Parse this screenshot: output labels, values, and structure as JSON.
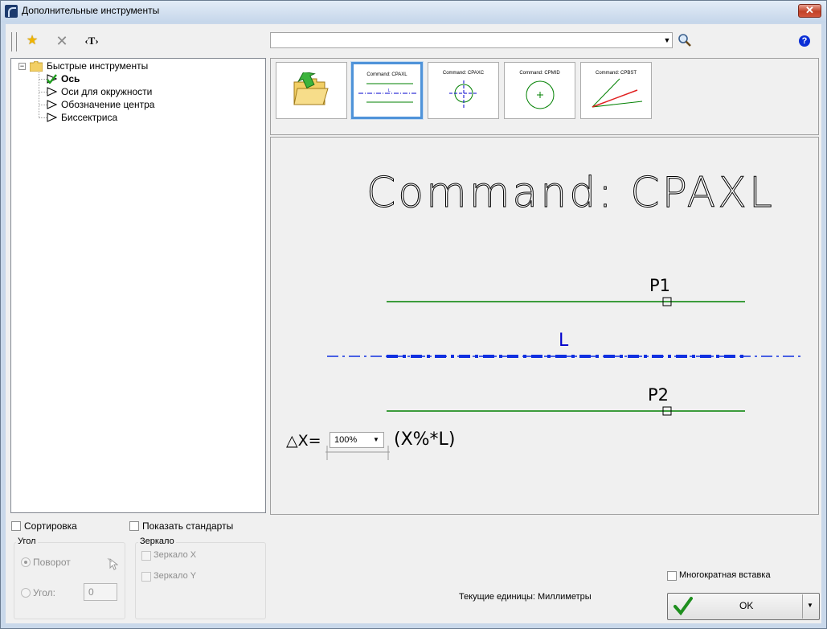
{
  "window": {
    "title": "Дополнительные инструменты",
    "close_glyph": "✕"
  },
  "toolbar": {
    "favorite_icon": "star-icon",
    "delete_icon": "x-icon",
    "text_button": "‹T›",
    "search_value": "",
    "help_glyph": "?"
  },
  "tree": {
    "root_label": "Быстрые инструменты",
    "items": [
      {
        "label": "Ось",
        "selected": true
      },
      {
        "label": "Оси для окружности",
        "selected": false
      },
      {
        "label": "Обозначение центра",
        "selected": false
      },
      {
        "label": "Биссектриса",
        "selected": false
      }
    ]
  },
  "gallery": {
    "thumbs": [
      {
        "caption": "",
        "icon": "folder-back-icon"
      },
      {
        "caption": "Command: CPAXL",
        "selected": true
      },
      {
        "caption": "Command: CPAXC"
      },
      {
        "caption": "Command: CPMID"
      },
      {
        "caption": "Command: CPBST"
      }
    ]
  },
  "preview": {
    "title": "Command: CPAXL",
    "p1": "P1",
    "p2": "P2",
    "l": "L",
    "delta": "△X=",
    "percent": "100%",
    "formula": "(X%*L)",
    "colors": {
      "green": "#008000",
      "blue": "#0000cc"
    }
  },
  "options": {
    "sort_label": "Сортировка",
    "show_standards_label": "Показать стандарты",
    "angle_group": "Угол",
    "rotation_label": "Поворот",
    "angle_label": "Угол:",
    "angle_value": "0",
    "mirror_group": "Зеркало",
    "mirror_x_label": "Зеркало X",
    "mirror_y_label": "Зеркало Y",
    "multi_insert_label": "Многократная вставка"
  },
  "status": {
    "units_text": "Текущие единицы: Миллиметры"
  },
  "ok": {
    "label": "OK"
  }
}
